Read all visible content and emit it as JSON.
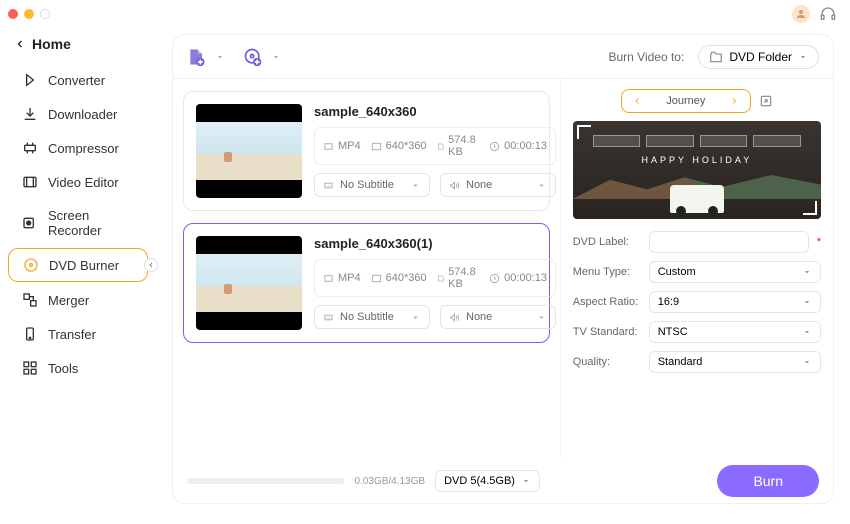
{
  "home": "Home",
  "sidebar": {
    "items": [
      {
        "label": "Converter"
      },
      {
        "label": "Downloader"
      },
      {
        "label": "Compressor"
      },
      {
        "label": "Video Editor"
      },
      {
        "label": "Screen Recorder"
      },
      {
        "label": "DVD Burner"
      },
      {
        "label": "Merger"
      },
      {
        "label": "Transfer"
      },
      {
        "label": "Tools"
      }
    ]
  },
  "toolbar": {
    "burn_to_label": "Burn Video to:",
    "burn_to_value": "DVD Folder"
  },
  "videos": [
    {
      "title": "sample_640x360",
      "format": "MP4",
      "resolution": "640*360",
      "size": "574.8 KB",
      "duration": "00:00:13",
      "subtitle": "No Subtitle",
      "audio": "None"
    },
    {
      "title": "sample_640x360(1)",
      "format": "MP4",
      "resolution": "640*360",
      "size": "574.8 KB",
      "duration": "00:00:13",
      "subtitle": "No Subtitle",
      "audio": "None"
    }
  ],
  "panel": {
    "template": "Journey",
    "preview_text": "HAPPY HOLIDAY",
    "label_dvd": "DVD Label:",
    "dvd_label_value": "",
    "label_menu": "Menu Type:",
    "menu_value": "Custom",
    "label_aspect": "Aspect Ratio:",
    "aspect_value": "16:9",
    "label_tv": "TV Standard:",
    "tv_value": "NTSC",
    "label_quality": "Quality:",
    "quality_value": "Standard"
  },
  "footer": {
    "size": "0.03GB/4.13GB",
    "disc": "DVD 5(4.5GB)",
    "burn": "Burn"
  }
}
